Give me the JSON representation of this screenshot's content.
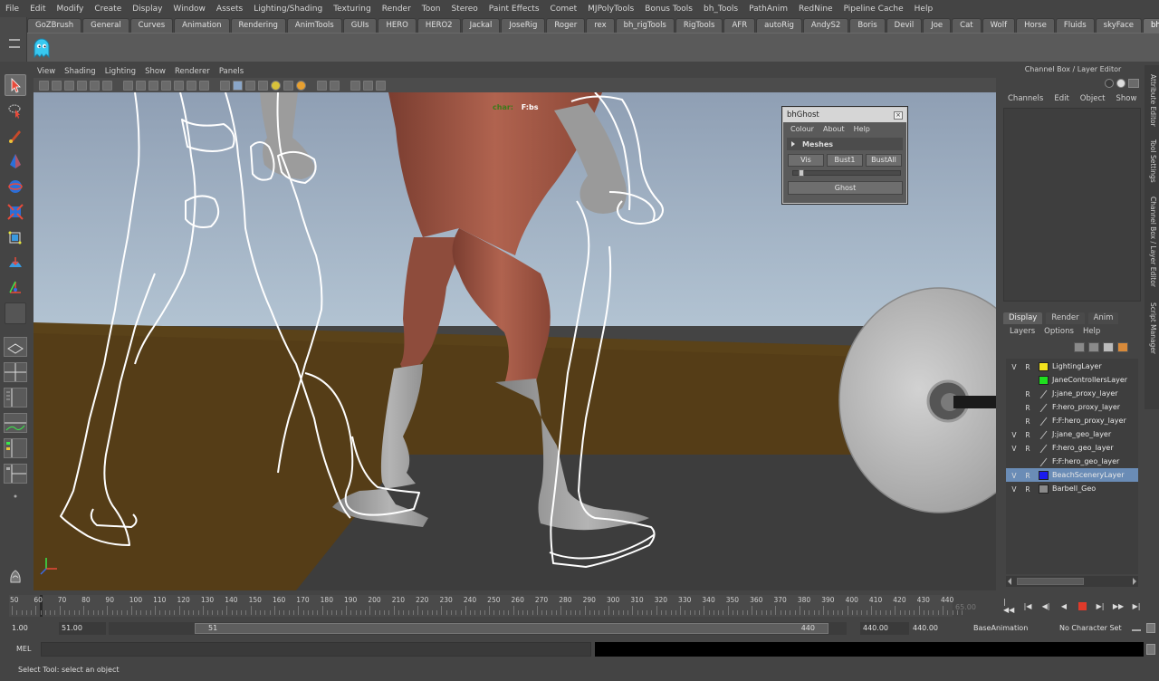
{
  "menubar": {
    "items": [
      "File",
      "Edit",
      "Modify",
      "Create",
      "Display",
      "Window",
      "Assets",
      "Lighting/Shading",
      "Texturing",
      "Render",
      "Toon",
      "Stereo",
      "Paint Effects",
      "Comet",
      "MJPolyTools",
      "Bonus Tools",
      "bh_Tools",
      "PathAnim",
      "RedNine",
      "Pipeline Cache",
      "Help"
    ]
  },
  "shelf": {
    "tabs": [
      "GoZBrush",
      "General",
      "Curves",
      "Animation",
      "Rendering",
      "AnimTools",
      "GUIs",
      "HERO",
      "HERO2",
      "Jackal",
      "JoseRig",
      "Roger",
      "rex",
      "bh_rigTools",
      "RigTools",
      "AFR",
      "autoRig",
      "AndyS2",
      "Boris",
      "Devil",
      "Joe",
      "Cat",
      "Wolf",
      "Horse",
      "Fluids",
      "skyFace",
      "bhGhost"
    ],
    "active_tab": "bhGhost"
  },
  "viewport": {
    "menu": [
      "View",
      "Shading",
      "Lighting",
      "Show",
      "Renderer",
      "Panels"
    ],
    "hud_label": "char:",
    "hud_value": "F:bs"
  },
  "ghost_window": {
    "title": "bhGhost",
    "menu": [
      "Colour",
      "About",
      "Help"
    ],
    "section": "Meshes",
    "buttons": [
      "Vis",
      "Bust1",
      "BustAll"
    ],
    "ghost_button": "Ghost"
  },
  "channel_box": {
    "title": "Channel Box / Layer Editor",
    "menu": [
      "Channels",
      "Edit",
      "Object",
      "Show"
    ]
  },
  "side_tabs": [
    "Attribute Editor",
    "Tool Settings",
    "Channel Box / Layer Editor",
    "Script Manager"
  ],
  "layer_editor": {
    "tabs": [
      "Display",
      "Render",
      "Anim"
    ],
    "active_tab": "Display",
    "menu": [
      "Layers",
      "Options",
      "Help"
    ],
    "layers": [
      {
        "v": "V",
        "r": "R",
        "color": "#f2e21e",
        "name": "LightingLayer",
        "selected": false
      },
      {
        "v": "",
        "r": "",
        "color": "#1fe01f",
        "name": "JaneControllersLayer",
        "selected": false
      },
      {
        "v": "",
        "r": "R",
        "color": "",
        "name": "J:jane_proxy_layer",
        "selected": false
      },
      {
        "v": "",
        "r": "R",
        "color": "",
        "name": "F:hero_proxy_layer",
        "selected": false
      },
      {
        "v": "",
        "r": "R",
        "color": "",
        "name": "F:F:hero_proxy_layer",
        "selected": false
      },
      {
        "v": "V",
        "r": "R",
        "color": "",
        "name": "J:jane_geo_layer",
        "selected": false
      },
      {
        "v": "V",
        "r": "R",
        "color": "",
        "name": "F:hero_geo_layer",
        "selected": false
      },
      {
        "v": "",
        "r": "",
        "color": "",
        "name": "F:F:hero_geo_layer",
        "selected": false
      },
      {
        "v": "V",
        "r": "R",
        "color": "#1a1aee",
        "name": "BeachSceneryLayer",
        "selected": true
      },
      {
        "v": "V",
        "r": "R",
        "color": "#8a8a8a",
        "name": "Barbell_Geo",
        "selected": false
      }
    ]
  },
  "time_slider": {
    "ticks": [
      "50",
      "60",
      "70",
      "80",
      "90",
      "100",
      "110",
      "120",
      "130",
      "140",
      "150",
      "160",
      "170",
      "180",
      "190",
      "200",
      "210",
      "220",
      "230",
      "240",
      "250",
      "260",
      "270",
      "280",
      "290",
      "300",
      "310",
      "320",
      "330",
      "340",
      "350",
      "360",
      "370",
      "380",
      "390",
      "400",
      "410",
      "420",
      "430",
      "440"
    ],
    "current_frame": "65.00"
  },
  "range_slider": {
    "start_time": "1.00",
    "playback_start": "51.00",
    "range_start_label": "51",
    "range_end_label": "440",
    "playback_end": "440.00",
    "end_time": "440.00",
    "anim_layer": "BaseAnimation",
    "character_set": "No Character Set"
  },
  "command_line": {
    "label": "MEL"
  },
  "help_line": {
    "text": "Select Tool: select an object"
  },
  "colors": {
    "sky_top": "#95a6bb",
    "sky_bottom": "#a9bcce",
    "floor": "#553d17",
    "ground": "#3f3f3f",
    "skin": "#a35a48",
    "ghost_line": "#ffffff"
  }
}
